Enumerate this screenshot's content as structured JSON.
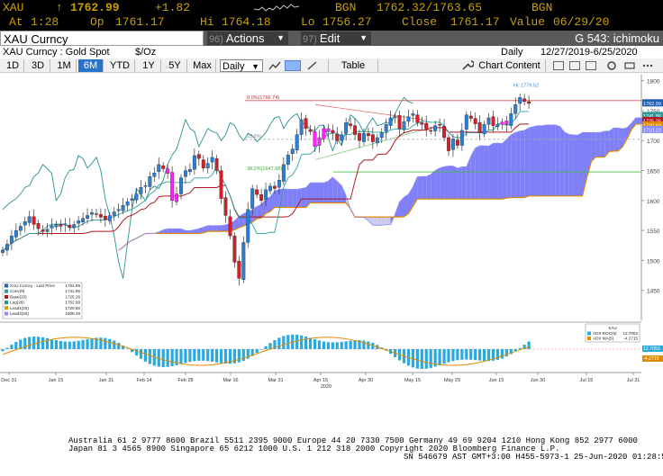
{
  "quote": {
    "ticker": "XAU",
    "arrow": "↑",
    "last": "1762.99",
    "change": "+1.82",
    "src1": "BGN",
    "bid_ask": "1762.32/1763.65",
    "src2": "BGN",
    "at_label": "At",
    "at_value": "1:28",
    "op_label": "Op",
    "op_value": "1761.17",
    "hi_label": "Hi",
    "hi_value": "1764.18",
    "lo_label": "Lo",
    "lo_value": "1756.27",
    "close_label": "Close",
    "close_value": "1761.17",
    "value_label": "Value",
    "value_date": "06/29/20"
  },
  "actionbar": {
    "security": "XAU Curncy",
    "actions_num": "96)",
    "actions_label": "Actions",
    "edit_num": "97)",
    "edit_label": "Edit",
    "chart_name": "G 543: ichimoku"
  },
  "secrow": {
    "name": "XAU Curncy : Gold Spot",
    "unit": "$/Oz",
    "period": "Daily",
    "range": "12/27/2019-6/25/2020"
  },
  "toolbar": {
    "ranges": [
      "1D",
      "3D",
      "1M",
      "6M",
      "YTD",
      "1Y",
      "5Y",
      "Max"
    ],
    "active_range": "6M",
    "frequency": "Daily",
    "table": "Table",
    "chart_content": "Chart Content"
  },
  "colors": {
    "up_candle": "#2a7fd4",
    "down_candle": "#d0202a",
    "highlight": "#ff22ff",
    "cloud": "#8080ff",
    "conversion": "#2aa0a0",
    "base": "#b01820",
    "leading2": "#e08a00"
  },
  "chart_data": {
    "type": "candlestick",
    "ylim": [
      1400,
      1810
    ],
    "y_ticks": [
      1450,
      1500,
      1550,
      1600,
      1650,
      1700,
      1750,
      1800
    ],
    "x_ticks": [
      "Dec 31",
      "Jan 15",
      "Jan 31",
      "Feb 14",
      "Feb 28",
      "Mar 16",
      "Mar 31",
      "Apr 15",
      "Apr 30",
      "May 15",
      "May 29",
      "Jun 15",
      "Jun 30",
      "Jul 15",
      "Jul 31"
    ],
    "year_label": "2020",
    "fib_lines": [
      {
        "label": "0.0%(1766.74)",
        "value": 1766.74
      },
      {
        "label": "23.6%",
        "value": 1702
      },
      {
        "label": "38.2%(1647.68)",
        "value": 1647.68
      }
    ],
    "high_annotation": "Hi: 1779.52",
    "right_labels": [
      "1762.99",
      "1741.86",
      "1725.26",
      "1720.60",
      "1710.22"
    ],
    "legend": [
      {
        "name": "XAU Curncy - Last Price",
        "value": "1762.99"
      },
      {
        "name": "Conv(9)",
        "value": "1741.86"
      },
      {
        "name": "Base(26)",
        "value": "1725.26"
      },
      {
        "name": "Lag(26)",
        "value": "1762.99"
      },
      {
        "name": "Lead1(26)",
        "value": "1720.60"
      },
      {
        "name": "Lead2(26)",
        "value": "1608.49"
      }
    ],
    "closes": [
      1517,
      1527,
      1541,
      1550,
      1557,
      1565,
      1573,
      1560,
      1553,
      1548,
      1552,
      1558,
      1560,
      1557,
      1561,
      1555,
      1560,
      1566,
      1570,
      1575,
      1580,
      1577,
      1572,
      1568,
      1575,
      1581,
      1585,
      1592,
      1598,
      1603,
      1611,
      1622,
      1625,
      1640,
      1646,
      1660,
      1653,
      1645,
      1600,
      1611,
      1638,
      1650,
      1652,
      1675,
      1670,
      1654,
      1662,
      1672,
      1650,
      1603,
      1575,
      1541,
      1497,
      1470,
      1530,
      1585,
      1620,
      1610,
      1600,
      1618,
      1624,
      1620,
      1634,
      1660,
      1676,
      1686,
      1710,
      1735,
      1720,
      1715,
      1690,
      1705,
      1720,
      1715,
      1713,
      1700,
      1710,
      1730,
      1725,
      1710,
      1700,
      1712,
      1708,
      1698,
      1705,
      1713,
      1727,
      1738,
      1740,
      1720,
      1732,
      1740,
      1745,
      1730,
      1727,
      1719,
      1716,
      1725,
      1726,
      1705,
      1683,
      1703,
      1692,
      1717,
      1743,
      1737,
      1728,
      1713,
      1727,
      1738,
      1725,
      1727,
      1731,
      1727,
      1745,
      1760,
      1772,
      1765,
      1762
    ],
    "adx": {
      "title": "XAU",
      "series": [
        {
          "name": "ADX ROC(5)",
          "value": "12.7053"
        },
        {
          "name": "ADX MA(5)",
          "value": "-4.2715"
        }
      ],
      "right_labels": [
        "12.7053",
        "-4.2715"
      ]
    }
  },
  "footer": {
    "line1": "Australia 61 2 9777 8600 Brazil 5511 2395 9000 Europe 44 20 7330 7500 Germany 49 69 9204 1210 Hong Kong 852 2977 6000",
    "line2": "Japan 81 3 4565 8900        Singapore 65 6212 1000        U.S. 1 212 318 2000          Copyright 2020 Bloomberg Finance L.P.",
    "line3": "SN 546679 AST  GMT+3:00 H455-5973-1 25-Jun-2020 01:28:59"
  }
}
